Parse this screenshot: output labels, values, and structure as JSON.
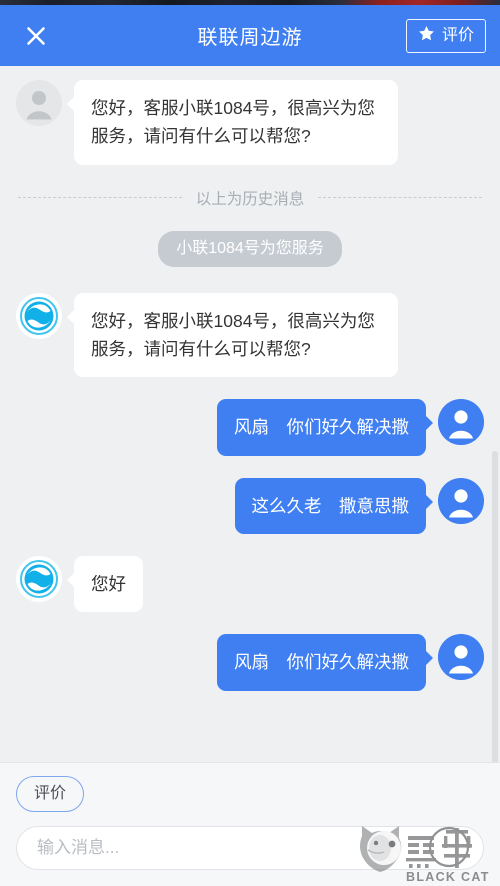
{
  "header": {
    "title": "联联周边游",
    "close_icon": "close-icon",
    "rate_button": {
      "label": "评价",
      "icon": "star-icon"
    },
    "background_color": "#3f7ff2",
    "text_color": "#ffffff"
  },
  "chat": {
    "background_color": "#eef0f2",
    "divider": {
      "text": "以上为历史消息"
    },
    "system_pill": {
      "text": "小联1084号为您服务",
      "background_color": "#c6cbd2"
    },
    "messages": [
      {
        "side": "agent",
        "avatar": "placeholder-person-avatar",
        "text": "您好，客服小联1084号，很高兴为您服务，请问有什么可以帮您?"
      },
      {
        "side": "agent",
        "avatar": "brand-logo-avatar",
        "text": "您好，客服小联1084号，很高兴为您服务，请问有什么可以帮您?"
      },
      {
        "side": "user",
        "avatar": "user-person-avatar",
        "text": "风扇　你们好久解决撒"
      },
      {
        "side": "user",
        "avatar": "user-person-avatar",
        "text": "这么久老　撒意思撒"
      },
      {
        "side": "agent",
        "avatar": "brand-logo-avatar",
        "text": "您好"
      },
      {
        "side": "user",
        "avatar": "user-person-avatar",
        "text": "风扇　你们好久解决撒"
      }
    ]
  },
  "footer": {
    "quick_actions": [
      {
        "label": "评价"
      }
    ],
    "input": {
      "value": "",
      "placeholder": "输入消息..."
    }
  },
  "watermark": {
    "cn_text": "黑猫",
    "en_text": "BLACK CAT",
    "icon": "black-cat-logo-icon"
  },
  "colors": {
    "brand_blue": "#3f7ff2",
    "logo_cyan": "#12b0e8",
    "page_bg": "#eef0f2",
    "bubble_white": "#ffffff",
    "muted_gray": "#a9aeb5"
  }
}
